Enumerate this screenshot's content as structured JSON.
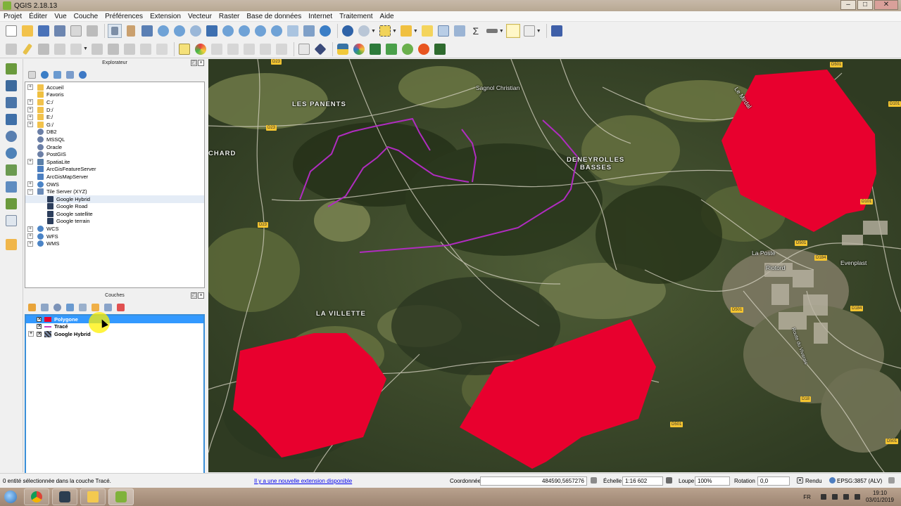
{
  "window": {
    "title": "QGIS 2.18.13",
    "controls": {
      "minimize": "–",
      "maximize": "□",
      "close": "✕"
    }
  },
  "menu": [
    "Projet",
    "Éditer",
    "Vue",
    "Couche",
    "Préférences",
    "Extension",
    "Vecteur",
    "Raster",
    "Base de données",
    "Internet",
    "Traitement",
    "Aide"
  ],
  "explorer": {
    "title": "Explorateur",
    "items": [
      {
        "label": "Accueil",
        "icon": "folder-icon",
        "expander": "+"
      },
      {
        "label": "Favoris",
        "icon": "star-folder-icon",
        "expander": ""
      },
      {
        "label": "C:/",
        "icon": "folder-icon",
        "expander": "+"
      },
      {
        "label": "D:/",
        "icon": "folder-icon",
        "expander": "+"
      },
      {
        "label": "E:/",
        "icon": "folder-icon",
        "expander": "+"
      },
      {
        "label": "G:/",
        "icon": "folder-icon",
        "expander": "+"
      },
      {
        "label": "DB2",
        "icon": "database-icon",
        "expander": ""
      },
      {
        "label": "MSSQL",
        "icon": "database-icon",
        "expander": ""
      },
      {
        "label": "Oracle",
        "icon": "database-icon",
        "expander": ""
      },
      {
        "label": "PostGIS",
        "icon": "database-icon",
        "expander": ""
      },
      {
        "label": "SpatiaLite",
        "icon": "feather-icon",
        "expander": "+"
      },
      {
        "label": "ArcGisFeatureServer",
        "icon": "server-icon",
        "expander": ""
      },
      {
        "label": "ArcGisMapServer",
        "icon": "server-icon",
        "expander": ""
      },
      {
        "label": "OWS",
        "icon": "globe-icon",
        "expander": "+"
      },
      {
        "label": "Tile Server (XYZ)",
        "icon": "tile-server-icon",
        "expander": "−"
      },
      {
        "label": "Google Hybrid",
        "icon": "tile-icon",
        "expander": "",
        "child": true
      },
      {
        "label": "Google Road",
        "icon": "tile-icon",
        "expander": "",
        "child": true
      },
      {
        "label": "Google satellite",
        "icon": "tile-icon",
        "expander": "",
        "child": true
      },
      {
        "label": "Google terrain",
        "icon": "tile-icon",
        "expander": "",
        "child": true
      },
      {
        "label": "WCS",
        "icon": "globe-icon",
        "expander": "+"
      },
      {
        "label": "WFS",
        "icon": "globe-icon",
        "expander": "+"
      },
      {
        "label": "WMS",
        "icon": "globe-icon",
        "expander": "+"
      }
    ]
  },
  "layers": {
    "title": "Couches",
    "items": [
      {
        "label": "Polygone",
        "selected": true,
        "symbol": "polygon-symbol-icon",
        "color": "#e8002e",
        "expander": ""
      },
      {
        "label": "Tracé",
        "selected": false,
        "symbol": "line-symbol-icon",
        "color": "#c040c0",
        "expander": ""
      },
      {
        "label": "Google Hybrid",
        "selected": false,
        "symbol": "raster-symbol-icon",
        "color": "#444444",
        "expander": "+"
      }
    ]
  },
  "map": {
    "places": [
      {
        "label": "LES PANENTS",
        "size": "big"
      },
      {
        "label": "Sagnol Christian",
        "size": "small"
      },
      {
        "label": "DENEYROLLES",
        "size": "big"
      },
      {
        "label": "BASSES",
        "size": "big"
      },
      {
        "label": "CHARD",
        "size": "big"
      },
      {
        "label": "LA VILLETTE",
        "size": "big"
      },
      {
        "label": "La Poste",
        "size": "small"
      },
      {
        "label": "Riotord",
        "size": "small"
      },
      {
        "label": "Evenplast",
        "size": "small"
      },
      {
        "label": "Le Mirdal",
        "size": "small"
      },
      {
        "label": "Route du Vivarais",
        "size": "small"
      }
    ],
    "roads": [
      "D23",
      "D23",
      "D23",
      "D501",
      "D101",
      "D101",
      "D501",
      "D184",
      "D184",
      "D501",
      "D18",
      "D501",
      "D501"
    ],
    "colors": {
      "polygon": "#e8002e",
      "trace": "#b02cc0"
    }
  },
  "status": {
    "message": "0 entité sélectionnée dans la couche Tracé.",
    "plugin_link": "Il y a une nouvelle extension disponible",
    "coord_label": "Coordonnée",
    "coord_value": "484590,5657276",
    "scale_label": "Échelle",
    "scale_value": "1:16 602",
    "magnifier_label": "Loupe",
    "magnifier_value": "100%",
    "rotation_label": "Rotation",
    "rotation_value": "0,0",
    "render_label": "Rendu",
    "crs": "EPSG:3857 (ALV)"
  },
  "taskbar": {
    "lang": "FR",
    "time": "19:10",
    "date": "03/01/2019",
    "apps": [
      "chrome-icon",
      "nox-icon",
      "file-explorer-icon",
      "qgis-icon"
    ]
  }
}
